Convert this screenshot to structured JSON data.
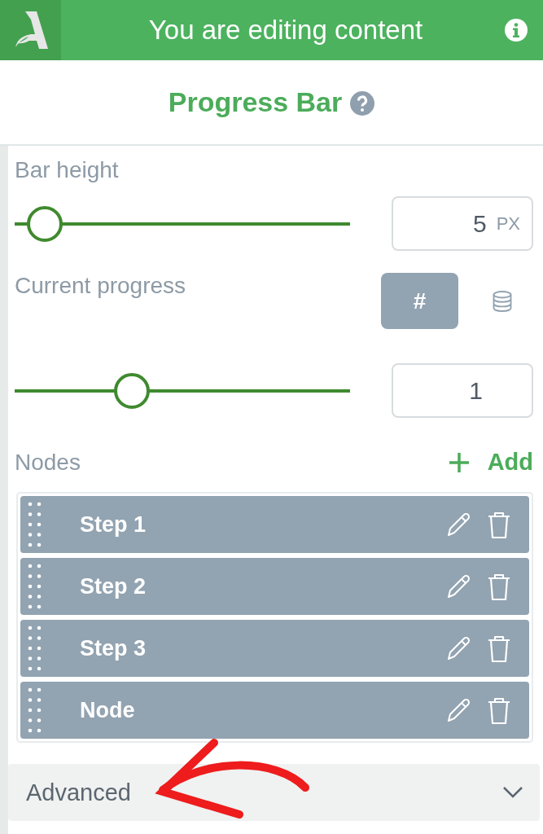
{
  "header": {
    "title": "You are editing content"
  },
  "widget": {
    "title": "Progress Bar"
  },
  "bar_height": {
    "label": "Bar height",
    "level": 0.09,
    "value": "5",
    "unit": "PX"
  },
  "current_progress": {
    "label": "Current progress",
    "modes": [
      {
        "kind": "text",
        "label": "#",
        "selected": true
      },
      {
        "kind": "database",
        "selected": false
      }
    ],
    "level": 0.35,
    "value": "1"
  },
  "nodes": {
    "label": "Nodes",
    "add_label": "Add",
    "items": [
      {
        "label": "Step 1"
      },
      {
        "label": "Step 2"
      },
      {
        "label": "Step 3"
      },
      {
        "label": "Node"
      }
    ]
  },
  "advanced": {
    "label": "Advanced",
    "expanded": false
  },
  "annotation": {
    "kind": "arrow"
  }
}
